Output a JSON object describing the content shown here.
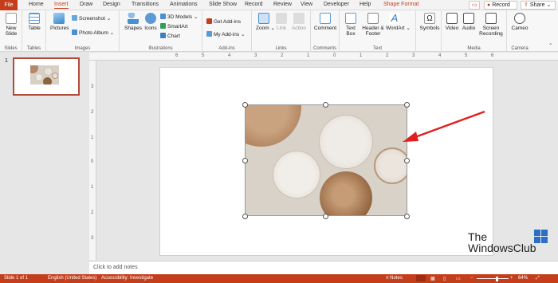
{
  "tabs": [
    "File",
    "Home",
    "Insert",
    "Draw",
    "Design",
    "Transitions",
    "Animations",
    "Slide Show",
    "Record",
    "Review",
    "View",
    "Developer",
    "Help",
    "Shape Format"
  ],
  "active_tab": "Insert",
  "title_buttons": {
    "record": "Record",
    "share": "Share"
  },
  "groups": {
    "slides": {
      "label": "Slides",
      "new_slide": "New Slide"
    },
    "tables": {
      "label": "Tables",
      "table": "Table"
    },
    "images": {
      "label": "Images",
      "pictures": "Pictures",
      "screenshot": "Screenshot",
      "photo_album": "Photo Album"
    },
    "illustrations": {
      "label": "Illustrations",
      "shapes": "Shapes",
      "icons": "Icons",
      "models": "3D Models",
      "smartart": "SmartArt",
      "chart": "Chart"
    },
    "addins": {
      "label": "Add-ins",
      "get": "Get Add-ins",
      "my": "My Add-ins"
    },
    "links": {
      "label": "Links",
      "zoom": "Zoom",
      "link": "Link",
      "action": "Action"
    },
    "comments": {
      "label": "Comments",
      "comment": "Comment"
    },
    "text": {
      "label": "Text",
      "textbox": "Text Box",
      "header_footer": "Header & Footer",
      "wordart": "WordArt"
    },
    "symbols": {
      "label": "",
      "symbols": "Symbols"
    },
    "media": {
      "label": "Media",
      "video": "Video",
      "audio": "Audio",
      "screen_recording": "Screen Recording"
    },
    "camera": {
      "label": "Camera",
      "cameo": "Cameo"
    }
  },
  "ruler_h": [
    "6",
    "5",
    "4",
    "3",
    "2",
    "1",
    "0",
    "1",
    "2",
    "3",
    "4",
    "5",
    "6"
  ],
  "ruler_v": [
    "3",
    "2",
    "1",
    "0",
    "1",
    "2",
    "3"
  ],
  "slide_number": "1",
  "notes_placeholder": "Click to add notes",
  "status": {
    "slide": "Slide 1 of 1",
    "language": "English (United States)",
    "accessibility": "Accessibility: Investigate",
    "notes": "Notes",
    "zoom": "64%"
  },
  "watermark": {
    "line1": "The",
    "line2": "WindowsClub"
  },
  "colors": {
    "accent": "#c43e1c",
    "arrow": "#e02020"
  }
}
